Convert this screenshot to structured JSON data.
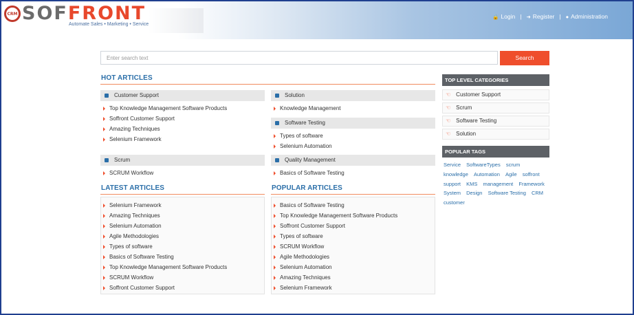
{
  "brand": {
    "badge": "CRM",
    "name_part1": "SOF",
    "name_part2": "FRONT",
    "tagline": "Automate Sales • Marketing • Service"
  },
  "topnav": {
    "login": "Login",
    "register": "Register",
    "administration": "Administration",
    "separator": "|"
  },
  "search": {
    "placeholder": "Enter search text",
    "button_label": "Search"
  },
  "hot_articles": {
    "title": "HOT ARTICLES",
    "categories": [
      {
        "name": "Customer Support",
        "items": [
          "Top Knowledge Management Software Products",
          "Soffront Customer Support",
          "Amazing Techniques",
          "Selenium Framework"
        ]
      },
      {
        "name": "Solution",
        "items": [
          "Knowledge Management"
        ]
      },
      {
        "name": "Software Testing",
        "items": [
          "Types of software",
          "Selenium Automation"
        ]
      },
      {
        "name": "Scrum",
        "items": [
          "SCRUM Workflow"
        ]
      },
      {
        "name": "Quality Management",
        "items": [
          "Basics of Software Testing"
        ]
      }
    ]
  },
  "latest_articles": {
    "title": "LATEST ARTICLES",
    "items": [
      "Selenium Framework",
      "Amazing Techniques",
      "Selenium Automation",
      "Agile Methodologies",
      "Types of software",
      "Basics of Software Testing",
      "Top Knowledge Management Software Products",
      "SCRUM Workflow",
      "Soffront Customer Support"
    ]
  },
  "popular_articles": {
    "title": "POPULAR ARTICLES",
    "items": [
      "Basics of Software Testing",
      "Top Knowledge Management Software Products",
      "Soffront Customer Support",
      "Types of software",
      "SCRUM Workflow",
      "Agile Methodologies",
      "Selenium Automation",
      "Amazing Techniques",
      "Selenium Framework"
    ]
  },
  "top_level_categories": {
    "title": "TOP LEVEL CATEGORIES",
    "items": [
      "Customer Support",
      "Scrum",
      "Software Testing",
      "Solution"
    ]
  },
  "popular_tags": {
    "title": "POPULAR TAGS",
    "tags": [
      "Service",
      "SoftwareTypes",
      "scrum",
      "knowledge",
      "Automation",
      "Agile",
      "soffront",
      "support",
      "KMS",
      "management",
      "Framework",
      "System",
      "Design",
      "Software Testing",
      "CRM",
      "customer"
    ]
  },
  "colors": {
    "accent": "#ef4e2c",
    "link_blue": "#2a6ea8",
    "sidebar_header": "#5d6166",
    "frame": "#1f3f8f"
  }
}
